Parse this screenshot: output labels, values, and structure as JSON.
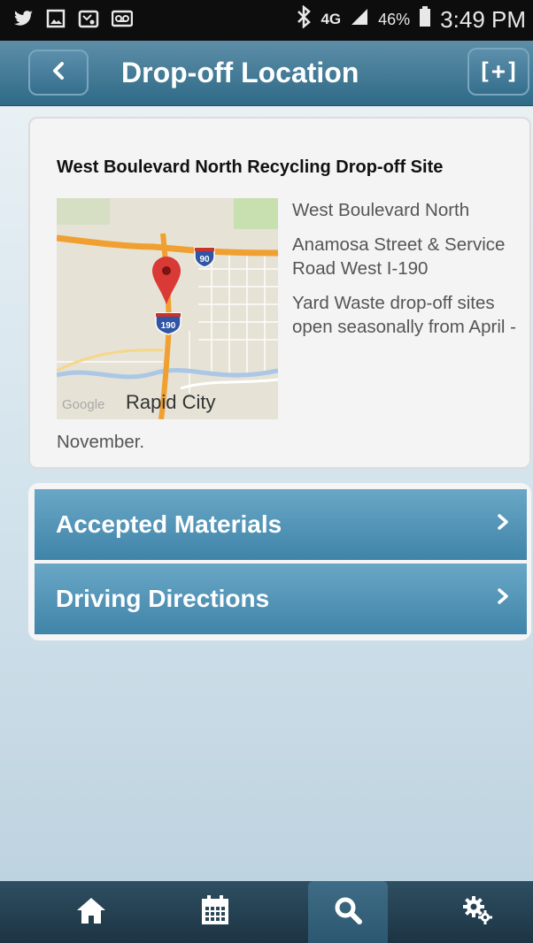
{
  "status_bar": {
    "battery_pct": "46%",
    "time": "3:49 PM",
    "network": "4G",
    "icons": [
      "twitter-icon",
      "gallery-icon",
      "missed-video-call-icon",
      "voicemail-icon",
      "bluetooth-icon",
      "signal-icon",
      "battery-icon"
    ]
  },
  "header": {
    "title": "Drop-off Location",
    "add_label": "[+]",
    "back_icon": "chevron-left-icon"
  },
  "location": {
    "name": "West Boulevard North Recycling Drop-off Site",
    "address_line": "West Boulevard North",
    "cross_street": "Anamosa Street & Service Road West I-190",
    "note_start": "Yard Waste drop-off sites open seasonally from April -",
    "note_end": "November."
  },
  "map": {
    "labels": {
      "provider": "Google",
      "city": "Rapid City",
      "shield_90": "90",
      "shield_190": "190"
    },
    "colors": {
      "highway": "#f0a030",
      "pin": "#d93a35",
      "shield": "#2f55a4",
      "water": "#aac7e6"
    }
  },
  "menu": {
    "items": [
      {
        "label": "Accepted Materials",
        "icon": "chevron-right-icon"
      },
      {
        "label": "Driving Directions",
        "icon": "chevron-right-icon"
      }
    ]
  },
  "tabbar": {
    "tabs": [
      {
        "icon": "home-icon",
        "active": false
      },
      {
        "icon": "calendar-icon",
        "active": false
      },
      {
        "icon": "search-icon",
        "active": true
      },
      {
        "icon": "settings-gears-icon",
        "active": false
      }
    ]
  },
  "colors": {
    "header": "#3f7593",
    "menu_item": "#4f93b8",
    "tabbar": "#243f50"
  }
}
